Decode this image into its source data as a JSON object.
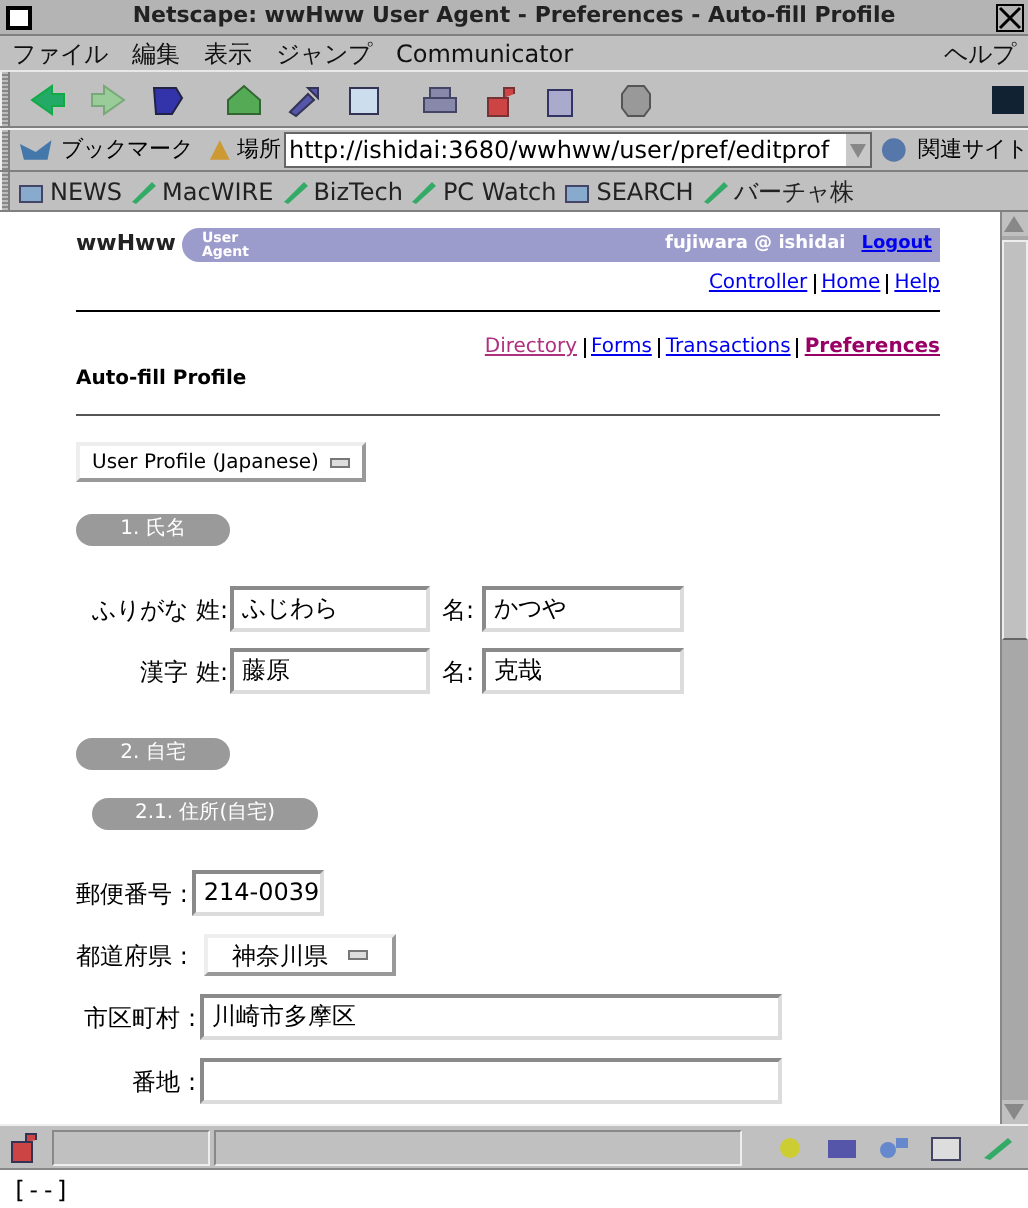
{
  "window": {
    "title": "Netscape: wwHww User Agent - Preferences - Auto-fill Profile"
  },
  "menu": {
    "items": [
      "ファイル",
      "編集",
      "表示",
      "ジャンプ",
      "Communicator"
    ],
    "help": "ヘルプ"
  },
  "location_bar": {
    "bookmarks": "ブックマーク",
    "location_label": "場所",
    "url": "http://ishidai:3680/wwhww/user/pref/editprof",
    "related": "関連サイト"
  },
  "personal_bar": [
    {
      "label": "NEWS",
      "kind": "folder"
    },
    {
      "label": "MacWIRE",
      "kind": "link"
    },
    {
      "label": "BizTech",
      "kind": "link"
    },
    {
      "label": "PC Watch",
      "kind": "link"
    },
    {
      "label": "SEARCH",
      "kind": "folder"
    },
    {
      "label": "バーチャ株",
      "kind": "link"
    }
  ],
  "page": {
    "brand": "wwHww",
    "badge_lines": [
      "User",
      "Agent"
    ],
    "user": "fujiwara @ ishidai",
    "logout": "Logout",
    "top_links": [
      "Controller",
      "Home",
      "Help"
    ],
    "section_links": [
      {
        "label": "Directory",
        "visited": true,
        "selected": false
      },
      {
        "label": "Forms",
        "visited": false,
        "selected": false
      },
      {
        "label": "Transactions",
        "visited": false,
        "selected": false
      },
      {
        "label": "Preferences",
        "visited": false,
        "selected": true
      }
    ],
    "heading": "Auto-fill Profile",
    "profile_select": "User Profile (Japanese)",
    "form": [
      {
        "kind": "heading",
        "label": "1. 氏名"
      },
      {
        "kind": "name_row",
        "label": "ふりがな 姓:",
        "first": "ふじわら",
        "second_label": "名:",
        "second": "かつや"
      },
      {
        "kind": "name_row",
        "label": "漢字 姓:",
        "first": "藤原",
        "second_label": "名:",
        "second": "克哉"
      },
      {
        "kind": "heading",
        "label": "2. 自宅"
      },
      {
        "kind": "subheading",
        "label": "2.1. 住所(自宅)"
      },
      {
        "kind": "short_field",
        "label": "郵便番号 :",
        "value": "214-0039"
      },
      {
        "kind": "select",
        "label": "都道府県 :",
        "value": "神奈川県"
      },
      {
        "kind": "long_field",
        "label": "市区町村 :",
        "value": "川崎市多摩区"
      },
      {
        "kind": "long_field",
        "label": "番地 :"
      }
    ]
  },
  "status_bar": {
    "text": "[--]"
  }
}
